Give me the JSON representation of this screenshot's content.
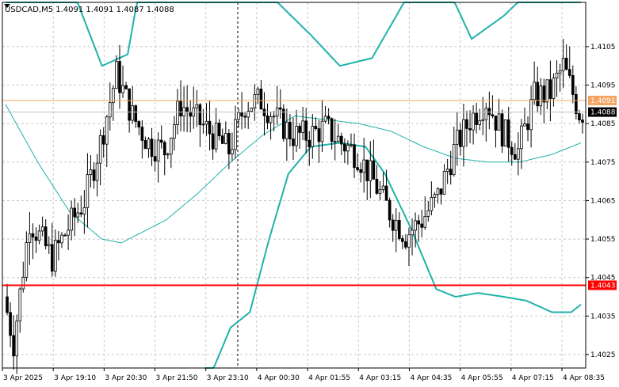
{
  "window": {
    "title": "USDCAD,M5  1.4091 1.4091 1.4087 1.4088"
  },
  "colors": {
    "background": "#ffffff",
    "candle": "#000000",
    "band": "#20b2aa",
    "ma": "#20b2aa",
    "resistance_line": "#f4a460",
    "support_line": "#ff0000",
    "support_badge": "#ff0000",
    "resistance_badge": "#f4a460",
    "price_badge": "#000000",
    "gridline": "#c8c8c8"
  },
  "chart_data": {
    "type": "candlestick",
    "symbol": "USDCAD",
    "timeframe": "M5",
    "grid": true,
    "ylim": [
      1.40215,
      1.41165
    ],
    "y_ticks": [
      "1.4105",
      "1.4095",
      "1.4085",
      "1.4075",
      "1.4065",
      "1.4055",
      "1.4045",
      "1.4035",
      "1.4025"
    ],
    "x_ticks": [
      "3 Apr 2025",
      "3 Apr 19:10",
      "3 Apr 20:30",
      "3 Apr 21:50",
      "3 Apr 23:10",
      "4 Apr 00:30",
      "4 Apr 01:55",
      "4 Apr 03:15",
      "4 Apr 04:35",
      "4 Apr 05:55",
      "4 Apr 07:15",
      "4 Apr 08:35"
    ],
    "horizontal_lines": [
      {
        "value": 1.4091,
        "label": "1.4091",
        "color": "#f4a460"
      },
      {
        "value": 1.4043,
        "label": "1.4043",
        "color": "#ff0000"
      }
    ],
    "current_price": {
      "value": 1.4088,
      "label": "1.4088"
    },
    "vertical_marker_index": 11,
    "candle_count": 180,
    "anchors": [
      {
        "i": 0,
        "v": 1.404
      },
      {
        "i": 3,
        "v": 1.4028
      },
      {
        "i": 8,
        "v": 1.406
      },
      {
        "i": 15,
        "v": 1.405
      },
      {
        "i": 20,
        "v": 1.4058
      },
      {
        "i": 25,
        "v": 1.4065
      },
      {
        "i": 30,
        "v": 1.408
      },
      {
        "i": 35,
        "v": 1.4098
      },
      {
        "i": 40,
        "v": 1.4087
      },
      {
        "i": 45,
        "v": 1.408
      },
      {
        "i": 50,
        "v": 1.4078
      },
      {
        "i": 55,
        "v": 1.409
      },
      {
        "i": 60,
        "v": 1.4086
      },
      {
        "i": 65,
        "v": 1.4082
      },
      {
        "i": 70,
        "v": 1.4078
      },
      {
        "i": 75,
        "v": 1.409
      },
      {
        "i": 80,
        "v": 1.4091
      },
      {
        "i": 85,
        "v": 1.4086
      },
      {
        "i": 90,
        "v": 1.4082
      },
      {
        "i": 95,
        "v": 1.4082
      },
      {
        "i": 100,
        "v": 1.4084
      },
      {
        "i": 105,
        "v": 1.408
      },
      {
        "i": 110,
        "v": 1.4077
      },
      {
        "i": 115,
        "v": 1.407
      },
      {
        "i": 120,
        "v": 1.4062
      },
      {
        "i": 125,
        "v": 1.4056
      },
      {
        "i": 130,
        "v": 1.406
      },
      {
        "i": 135,
        "v": 1.4066
      },
      {
        "i": 140,
        "v": 1.4078
      },
      {
        "i": 145,
        "v": 1.4086
      },
      {
        "i": 150,
        "v": 1.4091
      },
      {
        "i": 155,
        "v": 1.4083
      },
      {
        "i": 160,
        "v": 1.4078
      },
      {
        "i": 165,
        "v": 1.4092
      },
      {
        "i": 170,
        "v": 1.4093
      },
      {
        "i": 174,
        "v": 1.41
      },
      {
        "i": 179,
        "v": 1.4088
      }
    ],
    "upper_band": [
      {
        "i": 0,
        "v": 1.4165
      },
      {
        "i": 30,
        "v": 1.41
      },
      {
        "i": 38,
        "v": 1.4103
      },
      {
        "i": 48,
        "v": 1.415
      },
      {
        "i": 84,
        "v": 1.4117
      },
      {
        "i": 95,
        "v": 1.4108
      },
      {
        "i": 104,
        "v": 1.41
      },
      {
        "i": 114,
        "v": 1.4102
      },
      {
        "i": 125,
        "v": 1.4118
      },
      {
        "i": 135,
        "v": 1.4125
      },
      {
        "i": 145,
        "v": 1.4107
      },
      {
        "i": 155,
        "v": 1.4113
      },
      {
        "i": 165,
        "v": 1.4121
      },
      {
        "i": 179,
        "v": 1.4165
      }
    ],
    "lower_band": [
      {
        "i": 62,
        "v": 1.4016
      },
      {
        "i": 70,
        "v": 1.4032
      },
      {
        "i": 76,
        "v": 1.4036
      },
      {
        "i": 82,
        "v": 1.4055
      },
      {
        "i": 88,
        "v": 1.4072
      },
      {
        "i": 95,
        "v": 1.4079
      },
      {
        "i": 104,
        "v": 1.408
      },
      {
        "i": 112,
        "v": 1.4079
      },
      {
        "i": 118,
        "v": 1.4072
      },
      {
        "i": 126,
        "v": 1.4058
      },
      {
        "i": 134,
        "v": 1.4042
      },
      {
        "i": 140,
        "v": 1.404
      },
      {
        "i": 147,
        "v": 1.4041
      },
      {
        "i": 155,
        "v": 1.404
      },
      {
        "i": 162,
        "v": 1.4039
      },
      {
        "i": 170,
        "v": 1.4036
      },
      {
        "i": 176,
        "v": 1.4036
      },
      {
        "i": 179,
        "v": 1.4038
      }
    ],
    "middle_band": [
      {
        "i": 0,
        "v": 1.409
      },
      {
        "i": 10,
        "v": 1.4075
      },
      {
        "i": 20,
        "v": 1.4062
      },
      {
        "i": 30,
        "v": 1.4055
      },
      {
        "i": 36,
        "v": 1.4054
      },
      {
        "i": 50,
        "v": 1.406
      },
      {
        "i": 60,
        "v": 1.4067
      },
      {
        "i": 70,
        "v": 1.4075
      },
      {
        "i": 80,
        "v": 1.4082
      },
      {
        "i": 90,
        "v": 1.4087
      },
      {
        "i": 100,
        "v": 1.4086
      },
      {
        "i": 110,
        "v": 1.4085
      },
      {
        "i": 120,
        "v": 1.4083
      },
      {
        "i": 130,
        "v": 1.4079
      },
      {
        "i": 140,
        "v": 1.4076
      },
      {
        "i": 150,
        "v": 1.4075
      },
      {
        "i": 160,
        "v": 1.4075
      },
      {
        "i": 170,
        "v": 1.4077
      },
      {
        "i": 179,
        "v": 1.408
      }
    ]
  }
}
